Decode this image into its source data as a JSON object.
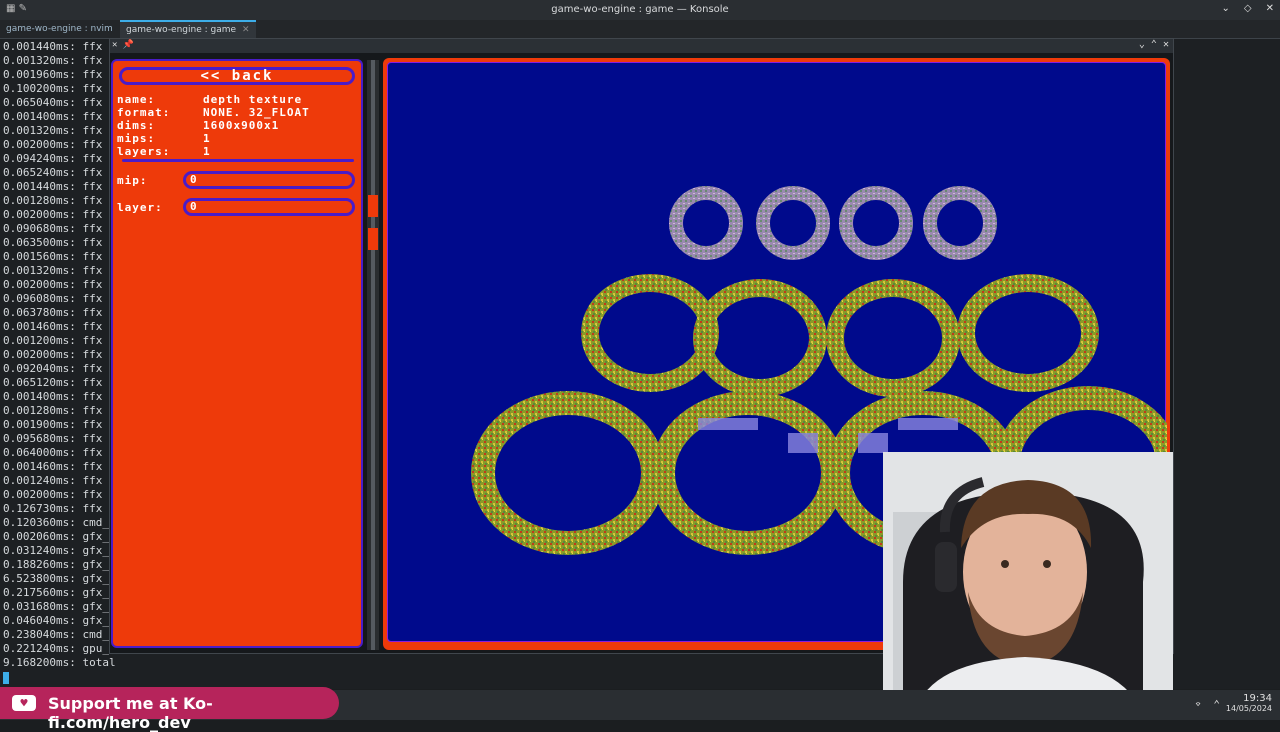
{
  "window": {
    "title": "game-wo-engine : game — Konsole"
  },
  "tabs": [
    {
      "label": "game-wo-engine : nvim"
    },
    {
      "label": "game-wo-engine : game"
    }
  ],
  "terminal_lines": [
    "0.001440ms: ffx",
    "0.001320ms: ffx",
    "0.001960ms: ffx",
    "0.100200ms: ffx",
    "0.065040ms: ffx",
    "0.001400ms: ffx",
    "0.001320ms: ffx",
    "0.002000ms: ffx",
    "0.094240ms: ffx",
    "0.065240ms: ffx",
    "0.001440ms: ffx",
    "0.001280ms: ffx",
    "0.002000ms: ffx",
    "0.090680ms: ffx",
    "0.063500ms: ffx",
    "0.001560ms: ffx",
    "0.001320ms: ffx",
    "0.002000ms: ffx",
    "0.096080ms: ffx",
    "0.063780ms: ffx",
    "0.001460ms: ffx",
    "0.001200ms: ffx",
    "0.002000ms: ffx",
    "0.092040ms: ffx",
    "0.065120ms: ffx",
    "0.001400ms: ffx",
    "0.001280ms: ffx",
    "0.001900ms: ffx",
    "0.095680ms: ffx",
    "0.064000ms: ffx",
    "0.001460ms: ffx",
    "0.001240ms: ffx",
    "0.002000ms: ffx",
    "0.126730ms: ffx",
    "0.120360ms: cmd_",
    "0.002060ms: gfx_",
    "0.031240ms: gfx_",
    "0.188260ms: gfx_",
    "6.523800ms: gfx_",
    "0.217560ms: gfx_",
    "0.031680ms: gfx_",
    "0.046040ms: gfx_",
    "0.238040ms: cmd_",
    "0.221240ms: gpu_",
    "9.168200ms: total"
  ],
  "game_window": {
    "left_icons": "✕ 📌",
    "controls": "⌄ ⌃ ✕"
  },
  "panel": {
    "back_label": "<< back",
    "info": [
      {
        "key": "name:",
        "value": "depth texture"
      },
      {
        "key": "format:",
        "value": "NONE. 32_FLOAT"
      },
      {
        "key": "dims:",
        "value": "1600x900x1"
      },
      {
        "key": "mips:",
        "value": "1"
      },
      {
        "key": "layers:",
        "value": "1"
      }
    ],
    "mip_label": "mip:",
    "mip_value": "0",
    "layer_label": "layer:",
    "layer_value": "0"
  },
  "kofi": {
    "text": "Support me at Ko-fi.com/hero_dev"
  },
  "tray": {
    "time": "19:34",
    "date": "14/05/2024"
  }
}
